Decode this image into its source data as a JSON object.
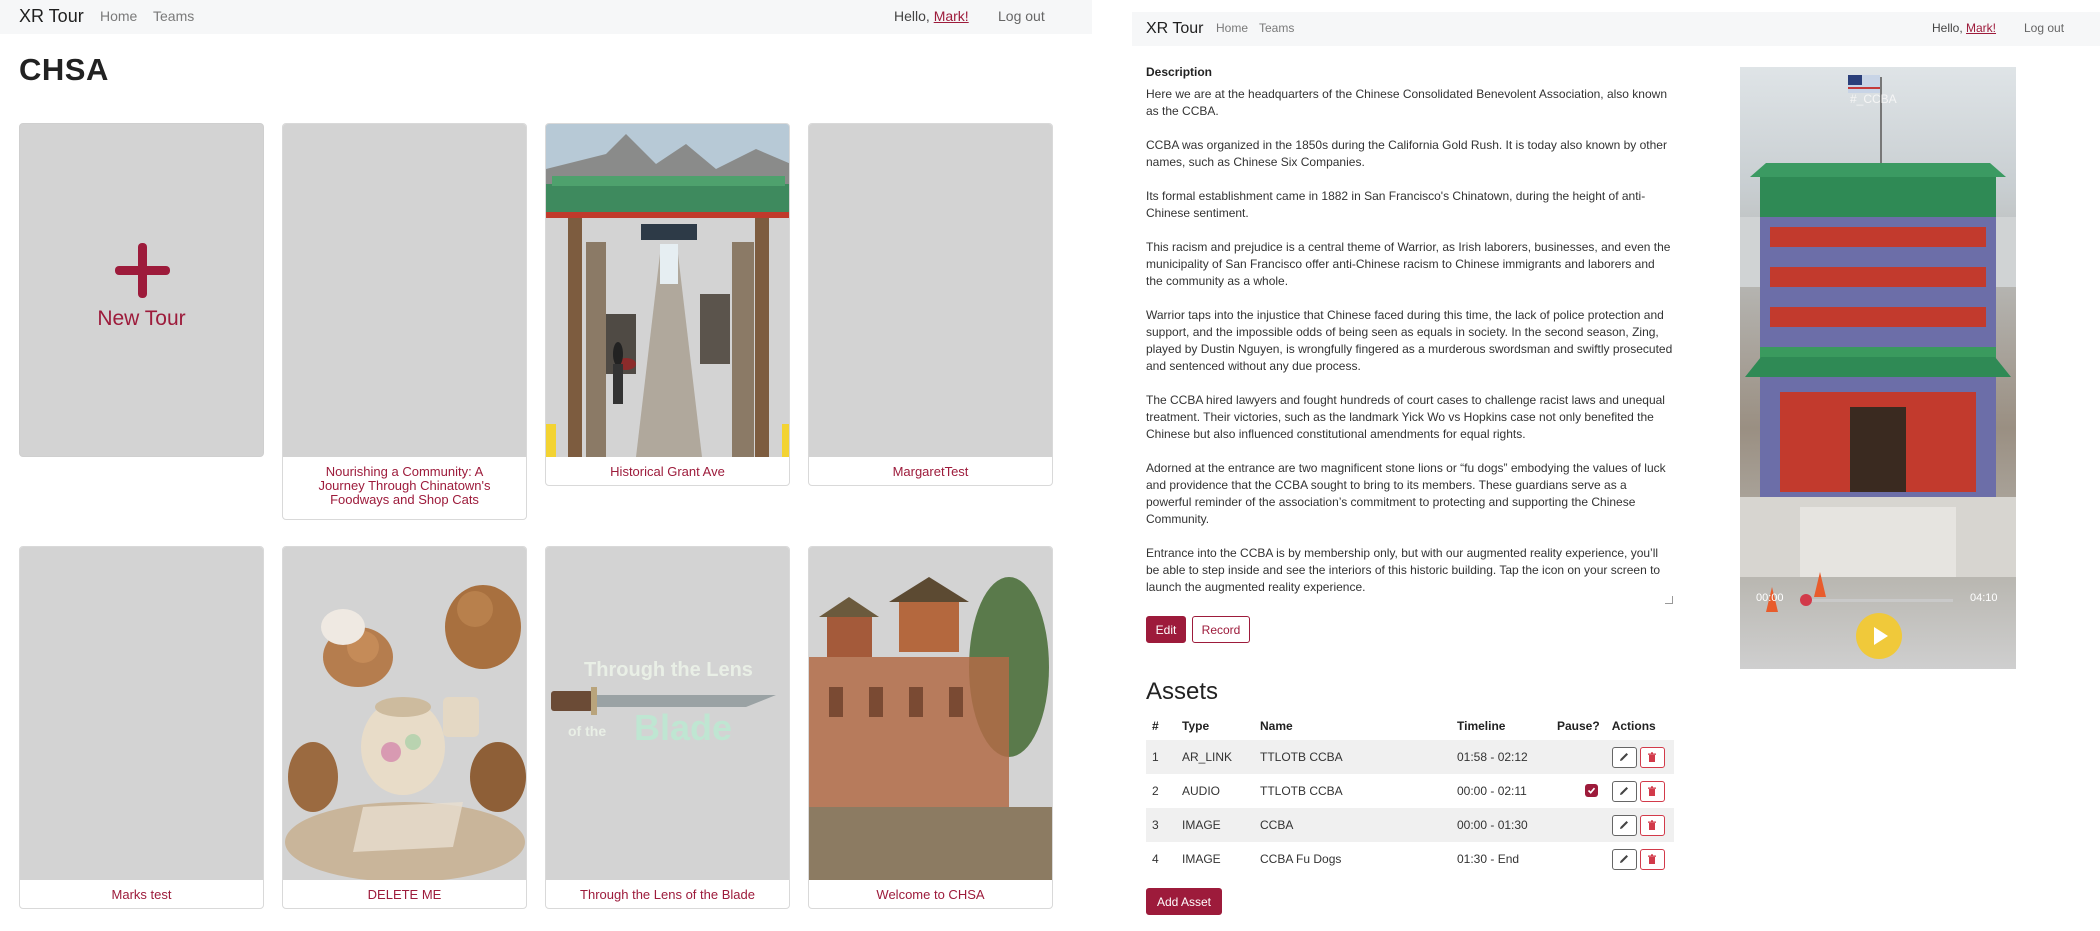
{
  "left_nav": {
    "brand": "XR Tour",
    "home": "Home",
    "teams": "Teams",
    "hello": "Hello, ",
    "user": "Mark!",
    "logout": "Log out"
  },
  "page_title": "CHSA",
  "new_tour_label": "New Tour",
  "tours": [
    {
      "title": "Nourishing a Community: A Journey Through Chinatown's Foodways and Shop Cats"
    },
    {
      "title": "Historical Grant Ave"
    },
    {
      "title": "MargaretTest"
    },
    {
      "title": "Marks test"
    },
    {
      "title": "DELETE ME"
    },
    {
      "title": "Through the Lens of the Blade",
      "art_line1": "Through the Lens",
      "art_of_the": "of the",
      "art_blade": "Blade"
    },
    {
      "title": "Welcome to CHSA"
    }
  ],
  "right_nav": {
    "brand": "XR Tour",
    "home": "Home",
    "teams": "Teams",
    "hello": "Hello, ",
    "user": "Mark!",
    "logout": "Log out"
  },
  "description": {
    "label": "Description",
    "paragraphs": [
      "Here we are at the headquarters of the Chinese Consolidated Benevolent Association, also known as the CCBA.",
      "CCBA was organized in the 1850s during the California Gold Rush. It is today also known by other names, such as Chinese Six Companies.",
      "Its formal establishment came in 1882 in San Francisco's Chinatown, during the height of anti-Chinese sentiment.",
      "This racism and prejudice is a central theme of Warrior, as Irish laborers, businesses, and even the municipality of San Francisco offer anti-Chinese racism to Chinese immigrants and laborers and the community as a whole.",
      "Warrior taps into the injustice that Chinese faced during this time, the lack of police protection and support, and the impossible odds of being seen as equals in society. In the second season, Zing, played by Dustin Nguyen, is wrongfully fingered as a murderous swordsman and swiftly prosecuted and sentenced without any due process.",
      "The CCBA hired lawyers and fought hundreds of court cases to challenge racist laws and unequal treatment. Their victories, such as the landmark Yick Wo vs Hopkins case not only benefited the Chinese but also influenced constitutional amendments for equal rights.",
      "Adorned at the entrance are two magnificent stone lions or “fu dogs” embodying the values of luck and providence that the CCBA sought to bring to its members. These guardians serve as a powerful reminder of the association’s commitment to protecting and supporting the Chinese Community.",
      "Entrance into the CCBA is by membership only, but with our augmented reality experience, you’ll be able to step inside and see the interiors of this historic building. Tap the icon on your screen to launch the augmented reality experience."
    ]
  },
  "buttons": {
    "edit": "Edit",
    "record": "Record",
    "add_asset": "Add Asset"
  },
  "assets": {
    "title": "Assets",
    "headers": [
      "#",
      "Type",
      "Name",
      "Timeline",
      "Pause?",
      "Actions"
    ],
    "rows": [
      {
        "num": "1",
        "type": "AR_LINK",
        "name": "TTLOTB CCBA",
        "timeline": "01:58 - 02:12",
        "pause": false
      },
      {
        "num": "2",
        "type": "AUDIO",
        "name": "TTLOTB CCBA",
        "timeline": "00:00 - 02:11",
        "pause": true
      },
      {
        "num": "3",
        "type": "IMAGE",
        "name": "CCBA",
        "timeline": "00:00 - 01:30",
        "pause": false
      },
      {
        "num": "4",
        "type": "IMAGE",
        "name": "CCBA Fu Dogs",
        "timeline": "01:30 - End",
        "pause": false
      }
    ]
  },
  "player": {
    "current_time": "00:00",
    "total_time": "04:10",
    "watermark": "#_CCBA"
  },
  "colors": {
    "accent": "#9d1b3b",
    "placeholder": "#d3d3d3",
    "play": "#f0c93a"
  }
}
